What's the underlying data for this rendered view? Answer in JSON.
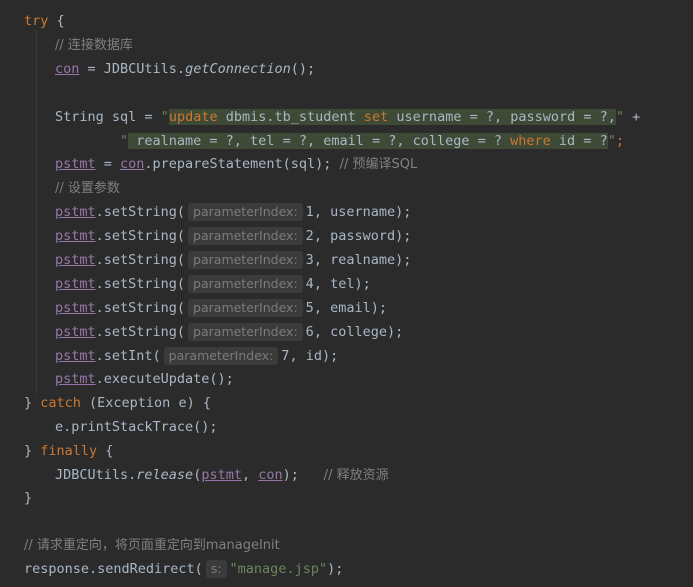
{
  "code": {
    "l1": {
      "kw": "try",
      "rest": " {"
    },
    "l2": {
      "comment": "// 连接数据库"
    },
    "l3": {
      "var": "con",
      "eq": " = JDBCUtils.",
      "call": "getConnection",
      "tail": "();"
    },
    "l4": {
      "type": "String sql = ",
      "q1": "\"",
      "sql_kw1": "update",
      "sql_a": " dbmis.tb_student ",
      "sql_kw2": "set",
      "sql_b": " username = ?, password = ?,",
      "q2": "\"",
      "plus": " +"
    },
    "l5": {
      "q1": "\"",
      "sql_a": " realname = ?, tel = ?, email = ?, college = ? ",
      "sql_kw": "where",
      "sql_b": " id = ?",
      "q2": "\"",
      "semi": ";"
    },
    "l6": {
      "var1": "pstmt",
      "eq": " = ",
      "var2": "con",
      "call": ".prepareStatement(sql);",
      "comment": "  // 预编译SQL"
    },
    "l7": {
      "comment": "// 设置参数"
    },
    "setters": [
      {
        "obj": "pstmt",
        "method": ".setString(",
        "hint": "parameterIndex:",
        "num": "1",
        "arg": ", username);"
      },
      {
        "obj": "pstmt",
        "method": ".setString(",
        "hint": "parameterIndex:",
        "num": "2",
        "arg": ", password);"
      },
      {
        "obj": "pstmt",
        "method": ".setString(",
        "hint": "parameterIndex:",
        "num": "3",
        "arg": ", realname);"
      },
      {
        "obj": "pstmt",
        "method": ".setString(",
        "hint": "parameterIndex:",
        "num": "4",
        "arg": ", tel);"
      },
      {
        "obj": "pstmt",
        "method": ".setString(",
        "hint": "parameterIndex:",
        "num": "5",
        "arg": ", email);"
      },
      {
        "obj": "pstmt",
        "method": ".setString(",
        "hint": "parameterIndex:",
        "num": "6",
        "arg": ", college);"
      },
      {
        "obj": "pstmt",
        "method": ".setInt(",
        "hint": "parameterIndex:",
        "num": "7",
        "arg": ", id);"
      }
    ],
    "l15": {
      "obj": "pstmt",
      "rest": ".executeUpdate();"
    },
    "l16": {
      "brace": "} ",
      "kw": "catch",
      "rest": " (Exception e) {"
    },
    "l17": {
      "text": "e.printStackTrace();"
    },
    "l18": {
      "brace": "} ",
      "kw": "finally",
      "rest": " {"
    },
    "l19": {
      "pre": "JDBCUtils.",
      "call": "release",
      "open": "(",
      "v1": "pstmt",
      "sep": ", ",
      "v2": "con",
      "close": ");",
      "comment": "      // 释放资源"
    },
    "l20": {
      "text": "}"
    },
    "l22": {
      "comment": "// 请求重定向，将页面重定向到manageInit"
    },
    "l23": {
      "pre": "response.sendRedirect(",
      "hint": "s:",
      "str": "\"manage.jsp\"",
      "tail": ");"
    }
  },
  "colors": {
    "background": "#2b2b2b",
    "keyword": "#cc7832",
    "string": "#6a8759",
    "comment": "#808080",
    "field": "#9876aa",
    "text": "#a9b7c6",
    "sql_highlight": "#3e4a36"
  }
}
